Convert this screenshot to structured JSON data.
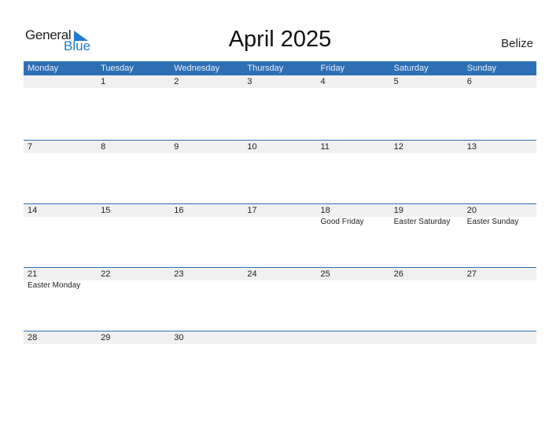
{
  "logo": {
    "line1": "General",
    "line2": "Blue"
  },
  "title": "April 2025",
  "country": "Belize",
  "colors": {
    "header": "#2e6fb3",
    "accent": "#1f7ad0",
    "date_strip": "#f0f0f0"
  },
  "weekdays": [
    "Monday",
    "Tuesday",
    "Wednesday",
    "Thursday",
    "Friday",
    "Saturday",
    "Sunday"
  ],
  "weeks": [
    [
      {
        "d": ""
      },
      {
        "d": "1"
      },
      {
        "d": "2"
      },
      {
        "d": "3"
      },
      {
        "d": "4"
      },
      {
        "d": "5"
      },
      {
        "d": "6"
      }
    ],
    [
      {
        "d": "7"
      },
      {
        "d": "8"
      },
      {
        "d": "9"
      },
      {
        "d": "10"
      },
      {
        "d": "11"
      },
      {
        "d": "12"
      },
      {
        "d": "13"
      }
    ],
    [
      {
        "d": "14"
      },
      {
        "d": "15"
      },
      {
        "d": "16"
      },
      {
        "d": "17"
      },
      {
        "d": "18",
        "h": "Good Friday"
      },
      {
        "d": "19",
        "h": "Easter Saturday"
      },
      {
        "d": "20",
        "h": "Easter Sunday"
      }
    ],
    [
      {
        "d": "21",
        "h": "Easter Monday"
      },
      {
        "d": "22"
      },
      {
        "d": "23"
      },
      {
        "d": "24"
      },
      {
        "d": "25"
      },
      {
        "d": "26"
      },
      {
        "d": "27"
      }
    ],
    [
      {
        "d": "28"
      },
      {
        "d": "29"
      },
      {
        "d": "30"
      },
      {
        "d": ""
      },
      {
        "d": ""
      },
      {
        "d": ""
      },
      {
        "d": ""
      }
    ]
  ]
}
